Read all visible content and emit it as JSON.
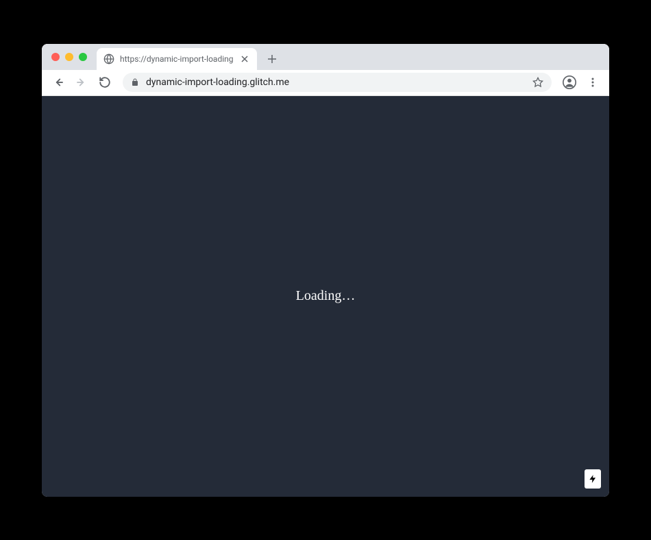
{
  "browser": {
    "tab": {
      "title": "https://dynamic-import-loading",
      "favicon": "globe-icon"
    },
    "toolbar": {
      "url": "dynamic-import-loading.glitch.me"
    }
  },
  "page": {
    "loading_text": "Loading…"
  },
  "colors": {
    "page_background": "#242b38",
    "text": "#ffffff"
  }
}
